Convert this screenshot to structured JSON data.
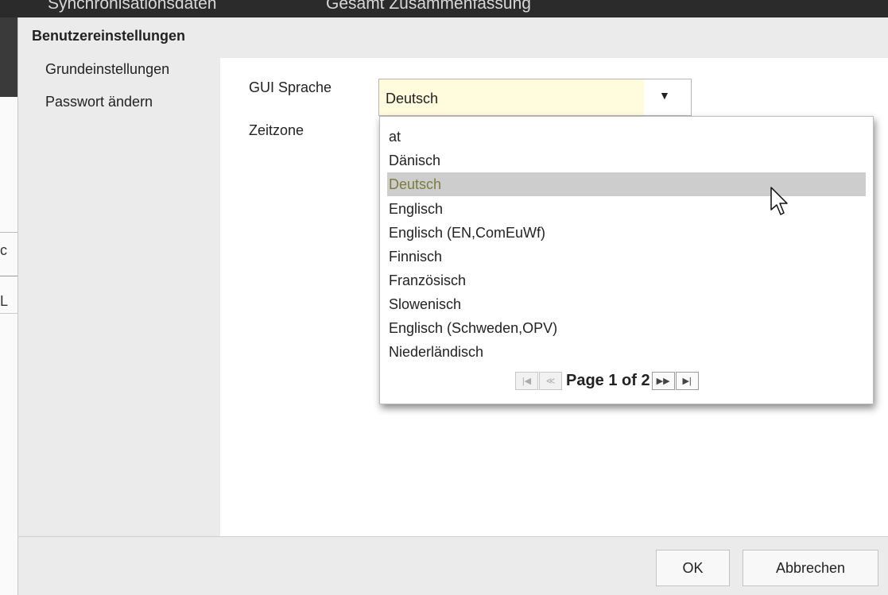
{
  "background": {
    "top_fragment_1": "Synchronisationsdaten",
    "top_fragment_2": "Gesamt Zusammenfassung",
    "left_fragment_1": "c",
    "left_fragment_2": "L"
  },
  "dialog": {
    "title": "Benutzereinstellungen",
    "sidebar": {
      "items": [
        {
          "label": "Grundeinstellungen",
          "active": true
        },
        {
          "label": "Passwort ändern",
          "active": false
        }
      ]
    },
    "fields": {
      "language_label": "GUI Sprache",
      "timezone_label": "Zeitzone",
      "language_value": "Deutsch"
    },
    "dropdown": {
      "options": [
        "at",
        "Dänisch",
        "Deutsch",
        "Englisch",
        "Englisch (EN,ComEuWf)",
        "Finnisch",
        "Französisch",
        "Slowenisch",
        "Englisch (Schweden,OPV)",
        "Niederländisch"
      ],
      "selected": "Deutsch",
      "pager": {
        "text": "Page 1 of 2",
        "first_icon": "first-page-icon",
        "prev_icon": "prev-page-icon",
        "next_icon": "next-page-icon",
        "last_icon": "last-page-icon"
      }
    },
    "buttons": {
      "ok": "OK",
      "cancel": "Abbrechen"
    }
  },
  "colors": {
    "selected_row": "#cdcdcd",
    "selected_text": "#7b7b3c",
    "input_highlight": "#fffbdc",
    "dialog_bg": "#ebebeb"
  },
  "icons": {
    "dropdown_arrow": "chevron-down-icon",
    "cursor": "mouse-pointer-icon"
  }
}
